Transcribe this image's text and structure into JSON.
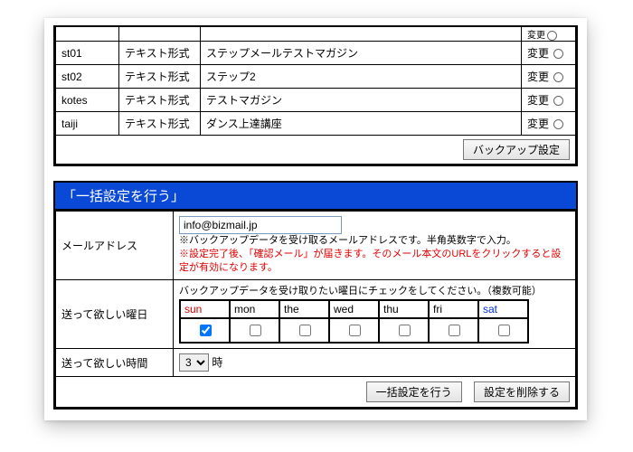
{
  "topTable": {
    "rows": [
      {
        "id": "st01",
        "fmt": "テキスト形式",
        "name": "ステップメールテストマガジン",
        "action": "変更"
      },
      {
        "id": "st02",
        "fmt": "テキスト形式",
        "name": "ステップ2",
        "action": "変更"
      },
      {
        "id": "kotes",
        "fmt": "テキスト形式",
        "name": "テストマガジン",
        "action": "変更"
      },
      {
        "id": "taiji",
        "fmt": "テキスト形式",
        "name": "ダンス上達講座",
        "action": "変更"
      }
    ],
    "partialAction": "変更",
    "footerButton": "バックアップ設定"
  },
  "bulk": {
    "title": "「一括設定を行う」",
    "emailLabel": "メールアドレス",
    "emailValue": "info@bizmail.jp",
    "note1": "※バックアップデータを受け取るメールアドレスです。半角英数字で入力。",
    "note2": "※設定完了後、「確認メール」が届きます。そのメール本文のURLをクリックすると設定が有効になります。",
    "daysLabel": "送って欲しい曜日",
    "daysNote": "バックアップデータを受け取りたい曜日にチェックをしてください。（複数可能）",
    "days": [
      "sun",
      "mon",
      "the",
      "wed",
      "thu",
      "fri",
      "sat"
    ],
    "checked": [
      true,
      false,
      false,
      false,
      false,
      false,
      false
    ],
    "timeLabel": "送って欲しい時間",
    "timeValue": "3",
    "timeUnit": "時",
    "submit": "一括設定を行う",
    "delete": "設定を削除する"
  }
}
